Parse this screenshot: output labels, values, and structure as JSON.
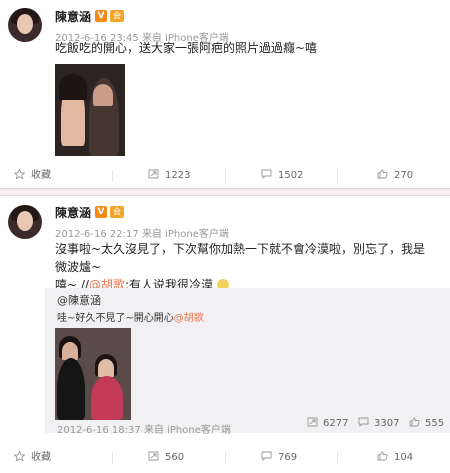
{
  "post1": {
    "author": "陳意涵",
    "badge_v": "V",
    "badge_vip": "会",
    "time": "2012-6-16 23:45",
    "source": "来自 iPhone客户端",
    "text": "吃飯吃的開心，送大家一張阿疤的照片過過癮~嘻",
    "actions": {
      "favorite_label": "收藏",
      "repost_count": "1223",
      "comment_count": "1502",
      "like_count": "270"
    }
  },
  "post2": {
    "author": "陳意涵",
    "badge_v": "V",
    "badge_vip": "会",
    "time": "2012-6-16 22:17",
    "source": "来自 iPhone客户端",
    "text_line1": "沒事啦~太久沒見了，下次幫你加熱一下就不會冷漠啦，別忘了，我是微波爐~",
    "text_line2_prefix": "嘻~ //",
    "text_line2_mention": "@胡歌",
    "text_line2_suffix": ":有人说我很冷漠",
    "forward": {
      "user": "@陳意涵",
      "text_prefix": "哇~好久不見了~開心開心",
      "text_mention": "@胡歌",
      "time": "2012-6-16 18:37",
      "source": "来自 iPhone客户端",
      "repost_count": "6277",
      "comment_count": "3307",
      "like_count": "555"
    },
    "actions": {
      "favorite_label": "收藏",
      "repost_count": "560",
      "comment_count": "769",
      "like_count": "104"
    }
  },
  "colors": {
    "link": "#eb7350",
    "vbadge": "#f48b17",
    "separator": "#f1e8ee"
  }
}
